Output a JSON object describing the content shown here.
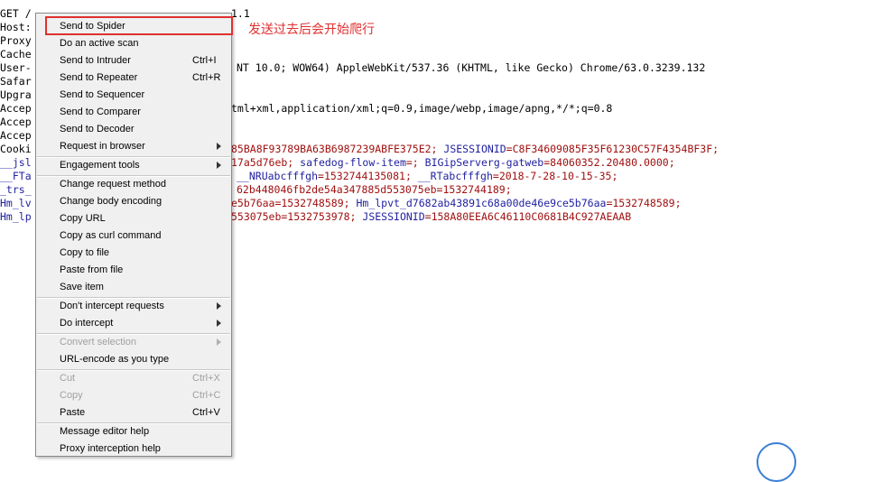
{
  "editor": {
    "lines": [
      {
        "a": "GET /",
        "b": "",
        "c": ""
      },
      {
        "a": "Host:",
        "b": "",
        "c": ""
      },
      {
        "a": "Proxy",
        "b": "",
        "c": ""
      },
      {
        "a": "Cache",
        "b": "",
        "c": ""
      },
      {
        "a": "User-",
        "b": "",
        "c": ""
      },
      {
        "a": "Safar",
        "b": "",
        "c": ""
      },
      {
        "a": "Upgra",
        "b": "",
        "c": ""
      },
      {
        "a": "Accep",
        "b": "",
        "c": ""
      },
      {
        "a": "Accep",
        "b": "",
        "c": ""
      },
      {
        "a": "Accep",
        "b": "",
        "c": ""
      },
      {
        "a": "Cooki",
        "b": "",
        "c": ""
      },
      {
        "a": "__jsl",
        "b": "",
        "c": ""
      },
      {
        "a": "__FTa",
        "b": "",
        "c": ""
      },
      {
        "a": "_trs_",
        "b": "",
        "c": ""
      },
      {
        "a": "Hm_lv",
        "b": "",
        "c": ""
      },
      {
        "a": "Hm_lp",
        "b": "",
        "c": ""
      }
    ],
    "top_fragment": "1.1",
    "right_fragments": {
      "user_agent": "NT 10.0; WOW64) AppleWebKit/537.36 (KHTML, like Gecko) Chrome/63.0.3239.132",
      "accept": "tml+xml,application/xml;q=0.9,image/webp,image/apng,*/*;q=0.8",
      "cookie_1a": "85BA8F93789BA63B6987239ABFE375E2; ",
      "cookie_1b": "JSESSIONID",
      "cookie_1c": "=C8F34609085F35F61230C57F4354BF3F;",
      "cookie_2a": "17a5d76eb; ",
      "cookie_2b": "safedog-flow-item",
      "cookie_2c": "=; ",
      "cookie_2d": "BIGipServerg-gatweb",
      "cookie_2e": "=84060352.20480.0000;",
      "cookie_3a": "__NRUabcfffgh",
      "cookie_3b": "=1532744135081; ",
      "cookie_3c": "__RTabcfffgh",
      "cookie_3d": "=2018-7-28-10-15-35;",
      "cookie_4a": "62b448046fb2de54a347885d553075eb=1532744189;",
      "cookie_5a": "e5b76aa=1532748589; ",
      "cookie_5b": "Hm_lpvt_d7682ab43891c68a00de46e9ce5b76aa",
      "cookie_5c": "=1532748589;",
      "cookie_6a": "553075eb=1532753978; ",
      "cookie_6b": "JSESSIONID",
      "cookie_6c": "=158A80EEA6C46110C0681B4C927AEAAB"
    }
  },
  "context_menu": {
    "items": [
      {
        "label": "Send to Spider",
        "shortcut": "",
        "submenu": false,
        "disabled": false
      },
      {
        "label": "Do an active scan",
        "shortcut": "",
        "submenu": false,
        "disabled": false
      },
      {
        "label": "Send to Intruder",
        "shortcut": "Ctrl+I",
        "submenu": false,
        "disabled": false
      },
      {
        "label": "Send to Repeater",
        "shortcut": "Ctrl+R",
        "submenu": false,
        "disabled": false
      },
      {
        "label": "Send to Sequencer",
        "shortcut": "",
        "submenu": false,
        "disabled": false
      },
      {
        "label": "Send to Comparer",
        "shortcut": "",
        "submenu": false,
        "disabled": false
      },
      {
        "label": "Send to Decoder",
        "shortcut": "",
        "submenu": false,
        "disabled": false
      },
      {
        "label": "Request in browser",
        "shortcut": "",
        "submenu": true,
        "disabled": false
      },
      {
        "label": "Engagement tools",
        "shortcut": "",
        "submenu": true,
        "disabled": false
      },
      {
        "label": "Change request method",
        "shortcut": "",
        "submenu": false,
        "disabled": false
      },
      {
        "label": "Change body encoding",
        "shortcut": "",
        "submenu": false,
        "disabled": false
      },
      {
        "label": "Copy URL",
        "shortcut": "",
        "submenu": false,
        "disabled": false
      },
      {
        "label": "Copy as curl command",
        "shortcut": "",
        "submenu": false,
        "disabled": false
      },
      {
        "label": "Copy to file",
        "shortcut": "",
        "submenu": false,
        "disabled": false
      },
      {
        "label": "Paste from file",
        "shortcut": "",
        "submenu": false,
        "disabled": false
      },
      {
        "label": "Save item",
        "shortcut": "",
        "submenu": false,
        "disabled": false
      },
      {
        "label": "Don't intercept requests",
        "shortcut": "",
        "submenu": true,
        "disabled": false
      },
      {
        "label": "Do intercept",
        "shortcut": "",
        "submenu": true,
        "disabled": false
      },
      {
        "label": "Convert selection",
        "shortcut": "",
        "submenu": true,
        "disabled": true
      },
      {
        "label": "URL-encode as you type",
        "shortcut": "",
        "submenu": false,
        "disabled": false
      },
      {
        "label": "Cut",
        "shortcut": "Ctrl+X",
        "submenu": false,
        "disabled": true
      },
      {
        "label": "Copy",
        "shortcut": "Ctrl+C",
        "submenu": false,
        "disabled": true
      },
      {
        "label": "Paste",
        "shortcut": "Ctrl+V",
        "submenu": false,
        "disabled": false
      },
      {
        "label": "Message editor help",
        "shortcut": "",
        "submenu": false,
        "disabled": false
      },
      {
        "label": "Proxy interception help",
        "shortcut": "",
        "submenu": false,
        "disabled": false
      }
    ]
  },
  "annotation": {
    "text": "发送过去后会开始爬行",
    "color": "#e03030"
  },
  "colors": {
    "cookie_key": "#1f1fa0",
    "cookie_value": "#a01010"
  }
}
